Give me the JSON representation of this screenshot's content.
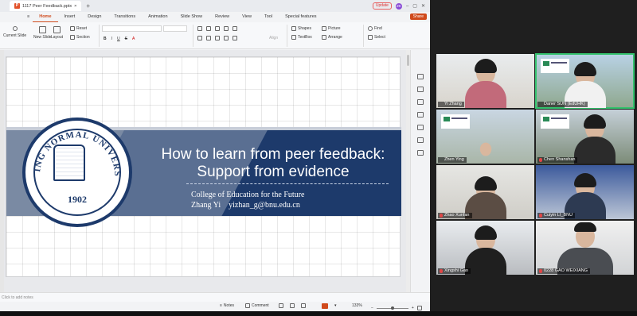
{
  "window": {
    "tab_title": "1117 Peer Feedback.pptx",
    "tab_close": "×",
    "new_tab": "+",
    "update_label": "Update",
    "avatar_initials": "ZK",
    "accent": "#d04a1c"
  },
  "menu": {
    "items": [
      "Home",
      "Insert",
      "Design",
      "Transitions",
      "Animation",
      "Slide Show",
      "Review",
      "View",
      "Tool",
      "Special features"
    ],
    "share_label": "Share"
  },
  "ribbon": {
    "current_slide": "Current Slide",
    "new_slide": "New Slide",
    "layout": "Layout",
    "reset": "Reset",
    "section": "Section",
    "shapes": "Shapes",
    "picture": "Picture",
    "textbox": "TextBox",
    "arrange": "Arrange",
    "find": "Find",
    "select": "Select",
    "align": "Align"
  },
  "slide": {
    "title_line1": "How to learn from peer feedback:",
    "title_line2": "Support from evidence",
    "subtitle_line1": "College of Education for the Future",
    "subtitle_line2": "Zhang Yi    yizhan_g@bnu.edu.cn",
    "seal_text": "BEIJING NORMAL UNIVERSITY",
    "seal_year": "1902",
    "colors": {
      "navy": "#1d3a6b",
      "grey": "#7a8aa3"
    }
  },
  "notes_placeholder": "Click to add notes",
  "status": {
    "notes": "Notes",
    "comment": "Comment",
    "zoom": "133%"
  },
  "participants": [
    {
      "name": "Yi Zhang",
      "muted": false,
      "active": false
    },
    {
      "name": "Daner SUN (EdUHK)",
      "muted": false,
      "active": true
    },
    {
      "name": "Zhen Ying",
      "muted": false,
      "active": false
    },
    {
      "name": "Chen Shanshan",
      "muted": true,
      "active": false
    },
    {
      "name": "Zhao Xunfan",
      "muted": true,
      "active": false
    },
    {
      "name": "Cuiyin LI_BNU",
      "muted": true,
      "active": false
    },
    {
      "name": "Xingshi Gao",
      "muted": true,
      "active": false
    },
    {
      "name": "0228 GAO WEIXIANG",
      "muted": true,
      "active": false
    }
  ]
}
